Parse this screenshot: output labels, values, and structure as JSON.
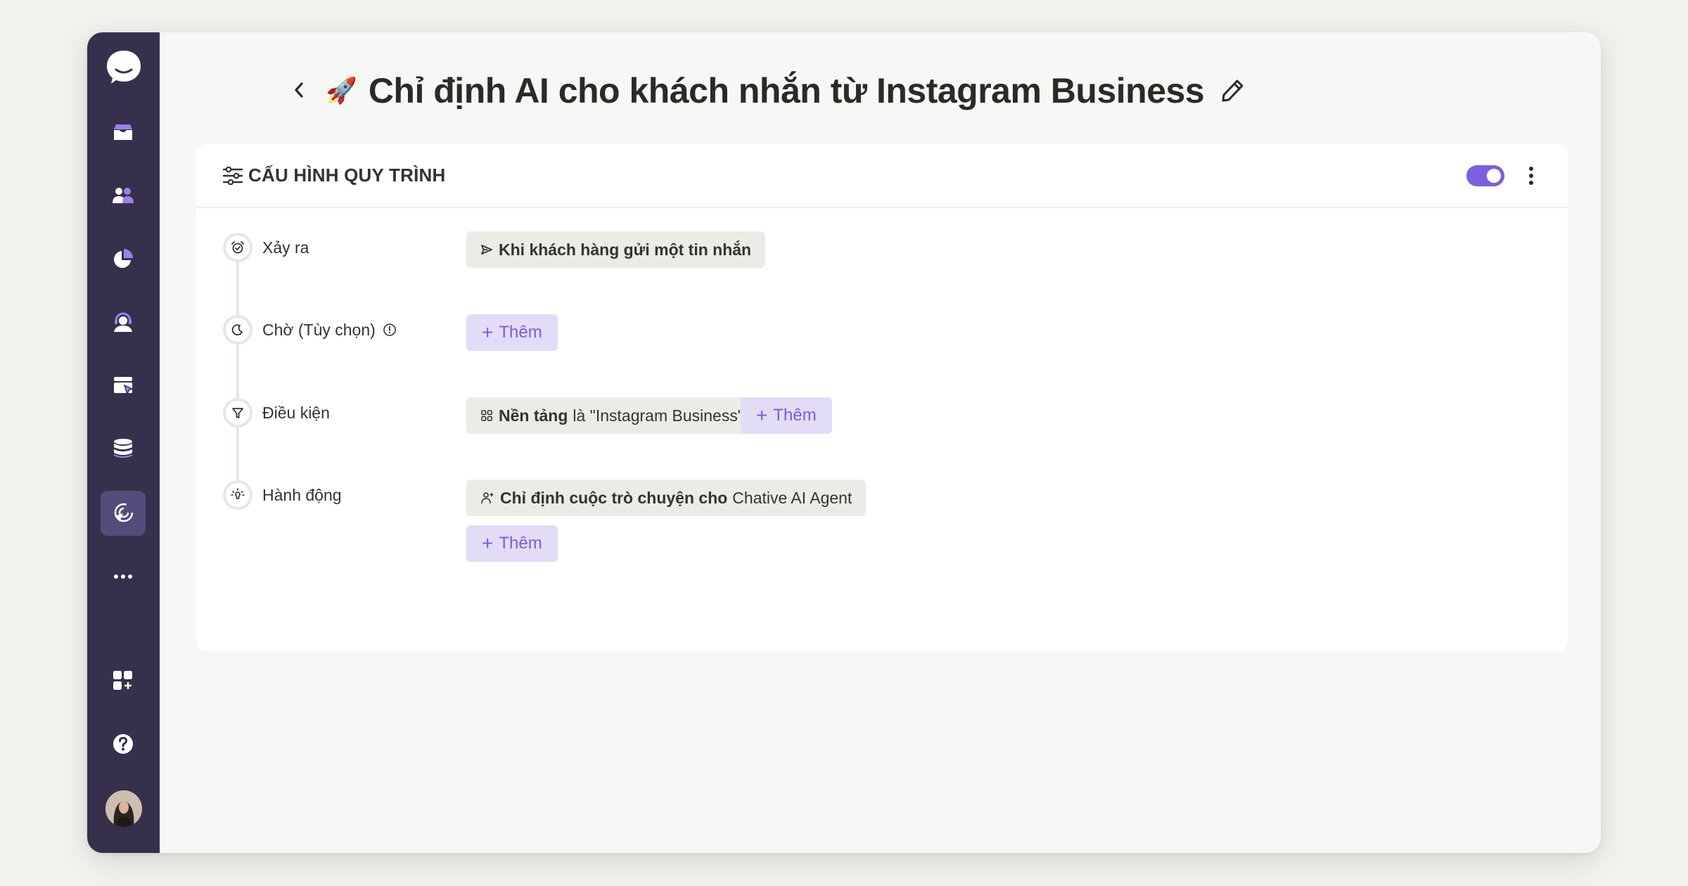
{
  "sidebar": {
    "logo": "chat-bubble-logo",
    "items": [
      {
        "name": "inbox",
        "icon": "inbox-icon",
        "active": false
      },
      {
        "name": "contacts",
        "icon": "users-icon",
        "active": false
      },
      {
        "name": "reports",
        "icon": "pie-chart-icon",
        "active": false
      },
      {
        "name": "agents",
        "icon": "headset-user-icon",
        "active": false
      },
      {
        "name": "campaigns",
        "icon": "window-cursor-icon",
        "active": false
      },
      {
        "name": "data",
        "icon": "database-icon",
        "active": false
      },
      {
        "name": "automation",
        "icon": "automation-icon",
        "active": true
      },
      {
        "name": "more",
        "icon": "more-horizontal-icon",
        "active": false
      }
    ],
    "bottom": [
      {
        "name": "apps",
        "icon": "apps-add-icon"
      },
      {
        "name": "help",
        "icon": "help-icon"
      },
      {
        "name": "profile",
        "icon": "avatar"
      }
    ]
  },
  "header": {
    "back_icon": "chevron-left-icon",
    "emoji": "🚀",
    "title": "Chỉ định AI cho khách nhắn từ Instagram Business",
    "edit_icon": "pencil-icon"
  },
  "card": {
    "title": "CẤU HÌNH QUY TRÌNH",
    "enabled": true,
    "accent_color": "#7c5fdc"
  },
  "steps": [
    {
      "label": "Xảy ra",
      "icon": "alarm-clock-icon",
      "chips": [
        {
          "icon": "send-icon",
          "bold": "Khi khách hàng gửi một tin nhắn",
          "rest": ""
        }
      ]
    },
    {
      "label": "Chờ (Tùy chọn)",
      "icon": "moon-icon",
      "info_icon": "info-icon",
      "chips": []
    },
    {
      "label": "Điều kiện",
      "icon": "filter-icon",
      "chips": [
        {
          "icon": "grid-icon",
          "bold": "Nền tảng",
          "rest": "là \"Instagram Business\""
        }
      ]
    },
    {
      "label": "Hành động",
      "icon": "lightbulb-icon",
      "chips": [
        {
          "icon": "user-plus-icon",
          "bold": "Chỉ định cuộc trò chuyện cho",
          "rest": "Chative AI Agent"
        }
      ]
    }
  ],
  "add_label": "Thêm",
  "add_symbol": "+"
}
